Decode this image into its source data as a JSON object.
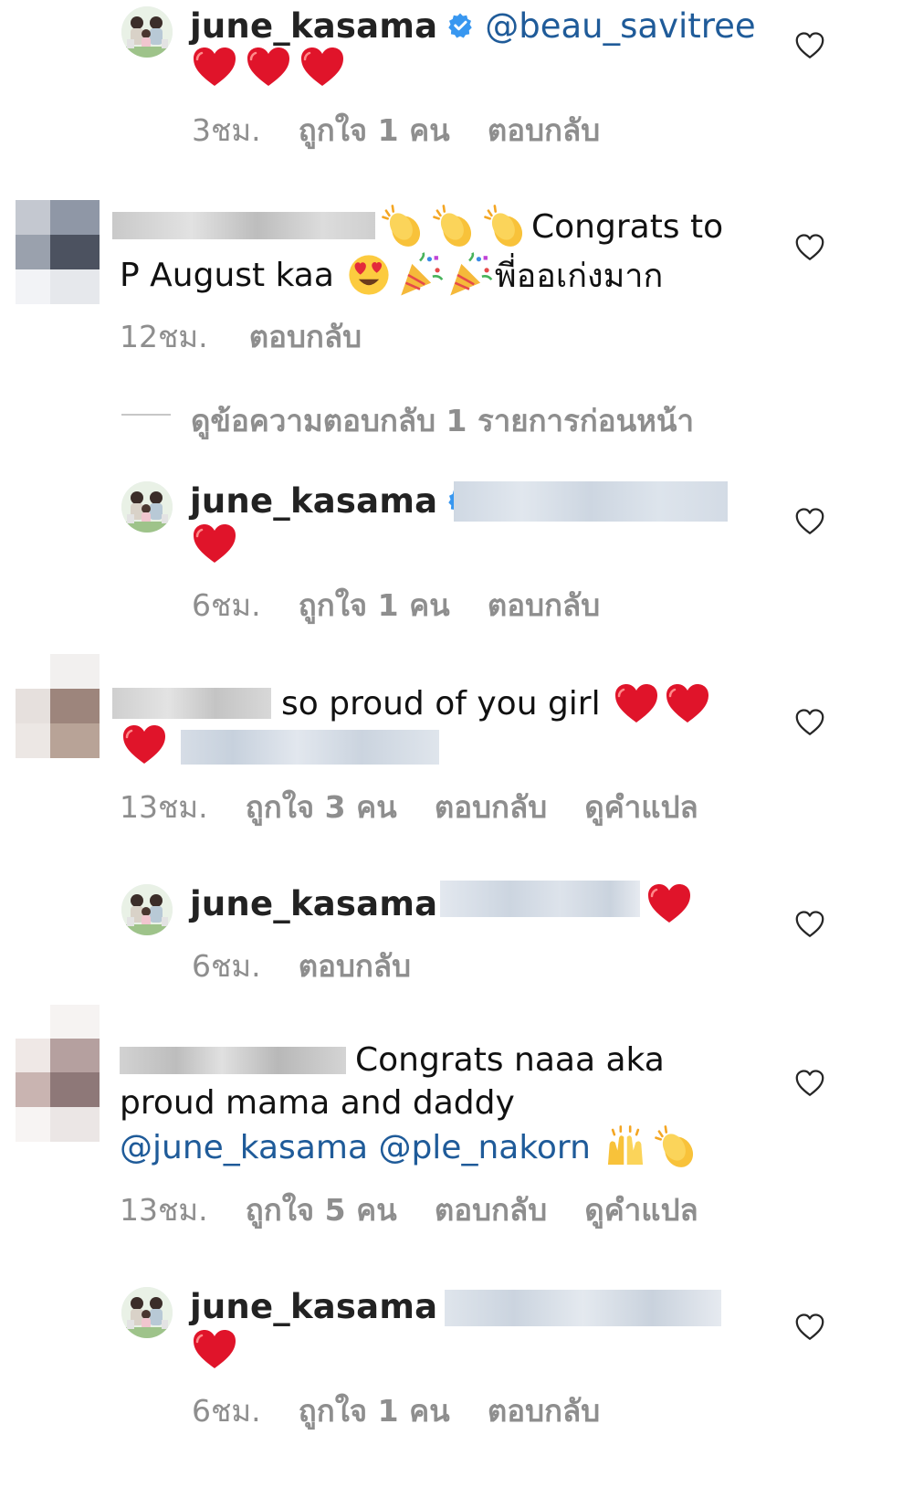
{
  "colors": {
    "link": "#1f5b99",
    "meta": "#8e8e8e",
    "heart": "#e0142a",
    "verified": "#3897f0"
  },
  "comments": [
    {
      "kind": "reply",
      "username": "june_kasama",
      "mention": "@beau_savitree",
      "time": "3ชม.",
      "likes": "ถูกใจ 1 คน",
      "reply": "ตอบกลับ"
    },
    {
      "kind": "comment",
      "line1": "Congrats to",
      "line2_a": "P August kaa",
      "line2_b": "พี่ออเก่งมาก",
      "time": "12ชม.",
      "reply": "ตอบกลับ"
    },
    {
      "kind": "view_replies",
      "label": "ดูข้อความตอบกลับ 1 รายการก่อนหน้า"
    },
    {
      "kind": "reply",
      "username": "june_kasama",
      "time": "6ชม.",
      "likes": "ถูกใจ 1 คน",
      "reply": "ตอบกลับ"
    },
    {
      "kind": "comment",
      "text": "so proud of you girl",
      "time": "13ชม.",
      "likes": "ถูกใจ 3 คน",
      "reply": "ตอบกลับ",
      "translate": "ดูคำแปล"
    },
    {
      "kind": "reply",
      "username": "june_kasama",
      "time": "6ชม.",
      "reply": "ตอบกลับ"
    },
    {
      "kind": "comment",
      "line1": "Congrats naaa aka",
      "line2": "proud mama and daddy",
      "mentions": "@june_kasama @ple_nakorn",
      "time": "13ชม.",
      "likes": "ถูกใจ 5 คน",
      "reply": "ตอบกลับ",
      "translate": "ดูคำแปล"
    },
    {
      "kind": "reply",
      "username": "june_kasama",
      "time": "6ชม.",
      "likes": "ถูกใจ 1 คน",
      "reply": "ตอบกลับ"
    }
  ],
  "icons": {
    "like": "heart-outline-icon",
    "verified": "verified-badge-icon"
  }
}
